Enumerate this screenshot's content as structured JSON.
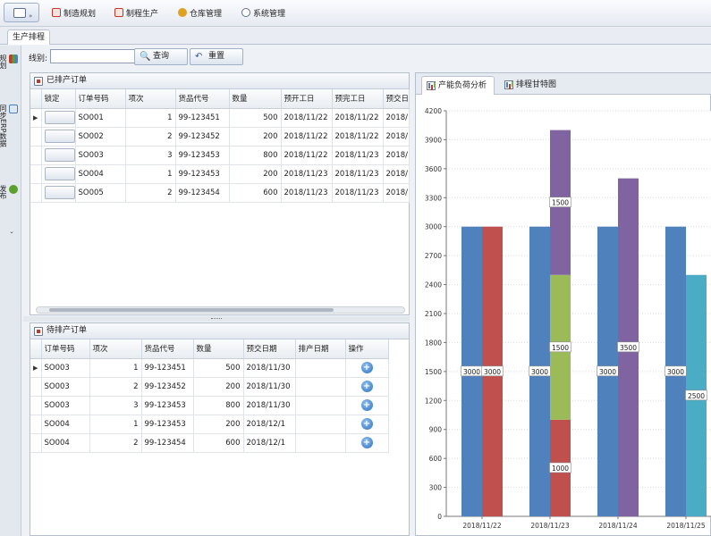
{
  "menu": {
    "items": [
      {
        "label": "制造规划",
        "icon": "calendar-icon",
        "color": "#c0392b"
      },
      {
        "label": "制程生产",
        "icon": "factory-icon",
        "color": "#c0392b"
      },
      {
        "label": "仓库管理",
        "icon": "warehouse-icon",
        "color": "#e0a020"
      },
      {
        "label": "系统管理",
        "icon": "settings-icon",
        "color": "#607090"
      }
    ]
  },
  "tabs": {
    "active": "生产排程"
  },
  "sidebar": {
    "items": [
      {
        "label": "规划",
        "icon": "bar-chart-icon",
        "color": "#c0392b"
      },
      {
        "label": "同步ERP数据",
        "icon": "sync-icon",
        "color": "#4a7fc1"
      },
      {
        "label": "发布",
        "icon": "publish-icon",
        "color": "#5aa02c"
      }
    ]
  },
  "toolbar": {
    "group_label": "线别:",
    "group_value": "",
    "query_label": "查询",
    "reset_label": "重置"
  },
  "scheduled": {
    "title": "已排产订单",
    "columns": [
      "锁定",
      "订单号码",
      "项次",
      "货品代号",
      "数量",
      "预开工日",
      "预完工日",
      "预交日"
    ],
    "rows": [
      {
        "order": "SO001",
        "item": "1",
        "product": "99-123451",
        "qty": "500",
        "start": "2018/11/22",
        "end": "2018/11/22",
        "due": "2018/11"
      },
      {
        "order": "SO002",
        "item": "2",
        "product": "99-123452",
        "qty": "200",
        "start": "2018/11/22",
        "end": "2018/11/22",
        "due": "2018/11"
      },
      {
        "order": "SO003",
        "item": "3",
        "product": "99-123453",
        "qty": "800",
        "start": "2018/11/22",
        "end": "2018/11/23",
        "due": "2018/11"
      },
      {
        "order": "SO004",
        "item": "1",
        "product": "99-123453",
        "qty": "200",
        "start": "2018/11/23",
        "end": "2018/11/23",
        "due": "2018/11"
      },
      {
        "order": "SO005",
        "item": "2",
        "product": "99-123454",
        "qty": "600",
        "start": "2018/11/23",
        "end": "2018/11/23",
        "due": "2018/11"
      }
    ]
  },
  "pending": {
    "title": "待排产订单",
    "columns": [
      "订单号码",
      "项次",
      "货品代号",
      "数量",
      "预交日期",
      "排产日期",
      "操作"
    ],
    "rows": [
      {
        "order": "SO003",
        "item": "1",
        "product": "99-123451",
        "qty": "500",
        "due": "2018/11/30",
        "plan": ""
      },
      {
        "order": "SO003",
        "item": "2",
        "product": "99-123452",
        "qty": "200",
        "due": "2018/11/30",
        "plan": ""
      },
      {
        "order": "SO003",
        "item": "3",
        "product": "99-123453",
        "qty": "800",
        "due": "2018/11/30",
        "plan": ""
      },
      {
        "order": "SO004",
        "item": "1",
        "product": "99-123453",
        "qty": "200",
        "due": "2018/12/1",
        "plan": ""
      },
      {
        "order": "SO004",
        "item": "2",
        "product": "99-123454",
        "qty": "600",
        "due": "2018/12/1",
        "plan": ""
      }
    ]
  },
  "chart_tabs": [
    {
      "label": "产能负荷分析",
      "active": true
    },
    {
      "label": "排程甘特图",
      "active": false
    }
  ],
  "chart_data": {
    "type": "bar",
    "categories": [
      "2018/11/22",
      "2018/11/23",
      "2018/11/24",
      "2018/11/25"
    ],
    "ylim": [
      0,
      4200
    ],
    "yticks": [
      0,
      300,
      600,
      900,
      1200,
      1500,
      1800,
      2100,
      2400,
      2700,
      3000,
      3300,
      3600,
      3900,
      4200
    ],
    "grid": true,
    "groups": [
      {
        "capacity": 3000,
        "capacity_label": "3000",
        "load": [
          {
            "value": 3000,
            "label": "3000",
            "color": "#c0504d"
          }
        ]
      },
      {
        "capacity": 3000,
        "capacity_label": "3000",
        "load": [
          {
            "value": 1000,
            "label": "1000",
            "color": "#c0504d"
          },
          {
            "value": 1500,
            "label": "1500",
            "color": "#9bbb59"
          },
          {
            "value": 1500,
            "label": "1500",
            "color": "#8064a2"
          }
        ]
      },
      {
        "capacity": 3000,
        "capacity_label": "3000",
        "load": [
          {
            "value": 3500,
            "label": "3500",
            "color": "#8064a2"
          }
        ]
      },
      {
        "capacity": 3000,
        "capacity_label": "3000",
        "load": [
          {
            "value": 2500,
            "label": "2500",
            "color": "#4bacc6"
          }
        ]
      }
    ],
    "capacity_color": "#4f81bd"
  }
}
